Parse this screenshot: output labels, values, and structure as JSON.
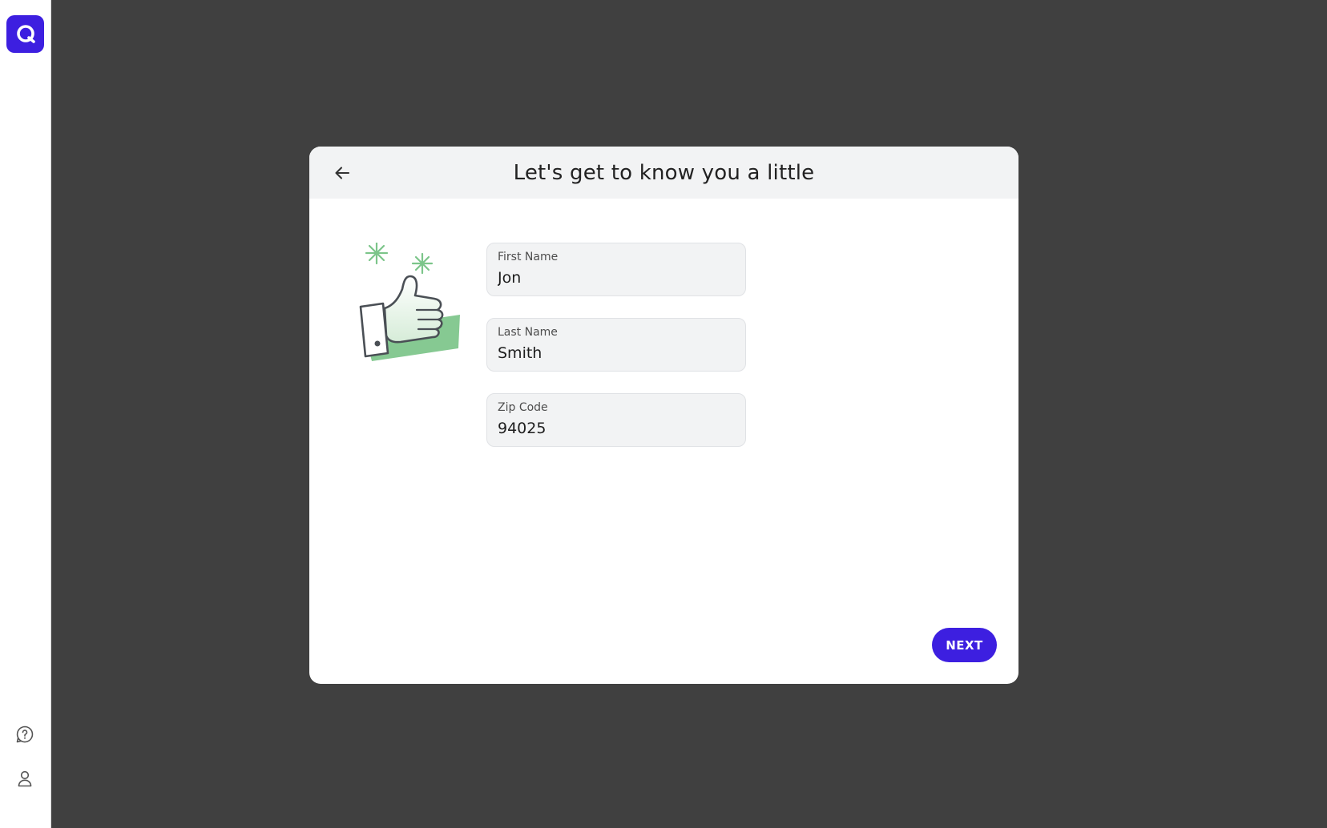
{
  "app": {
    "accent_color": "#3d1fe0",
    "logo_icon": "q-logo-icon"
  },
  "sidebar": {
    "bottom_icons": [
      {
        "name": "help-icon"
      },
      {
        "name": "account-icon"
      }
    ]
  },
  "dialog": {
    "title": "Let's get to know you a little",
    "back_icon": "arrow-left-icon",
    "illustration": "thumbs-up-illustration",
    "fields": [
      {
        "label": "First Name",
        "value": "Jon"
      },
      {
        "label": "Last Name",
        "value": "Smith"
      },
      {
        "label": "Zip Code",
        "value": "94025"
      }
    ],
    "next_label": "NEXT"
  }
}
